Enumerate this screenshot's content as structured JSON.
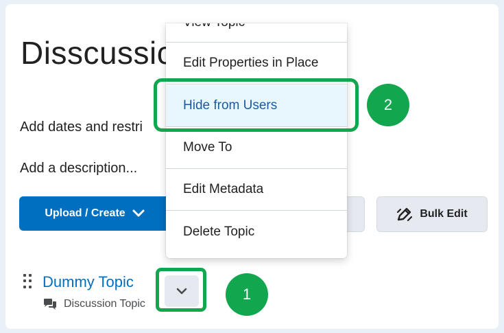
{
  "page": {
    "title": "Disscussic",
    "dates_line": "Add dates and restri",
    "description_line": "Add a description..."
  },
  "toolbar": {
    "upload_label": "Upload / Create",
    "bulk_edit_label": "Bulk Edit"
  },
  "topic": {
    "name": "Dummy Topic",
    "type": "Discussion Topic"
  },
  "context_menu": {
    "items": [
      {
        "label": "View Topic"
      },
      {
        "label": "Edit Properties in Place"
      },
      {
        "label": "Hide from Users"
      },
      {
        "label": "Move To"
      },
      {
        "label": "Edit Metadata"
      },
      {
        "label": "Delete Topic"
      }
    ]
  },
  "annotations": {
    "step_1": "1",
    "step_2": "2"
  },
  "colors": {
    "brand_blue": "#006fbf",
    "highlight_green": "#12a64e",
    "menu_active_bg": "#e8f7fe"
  }
}
